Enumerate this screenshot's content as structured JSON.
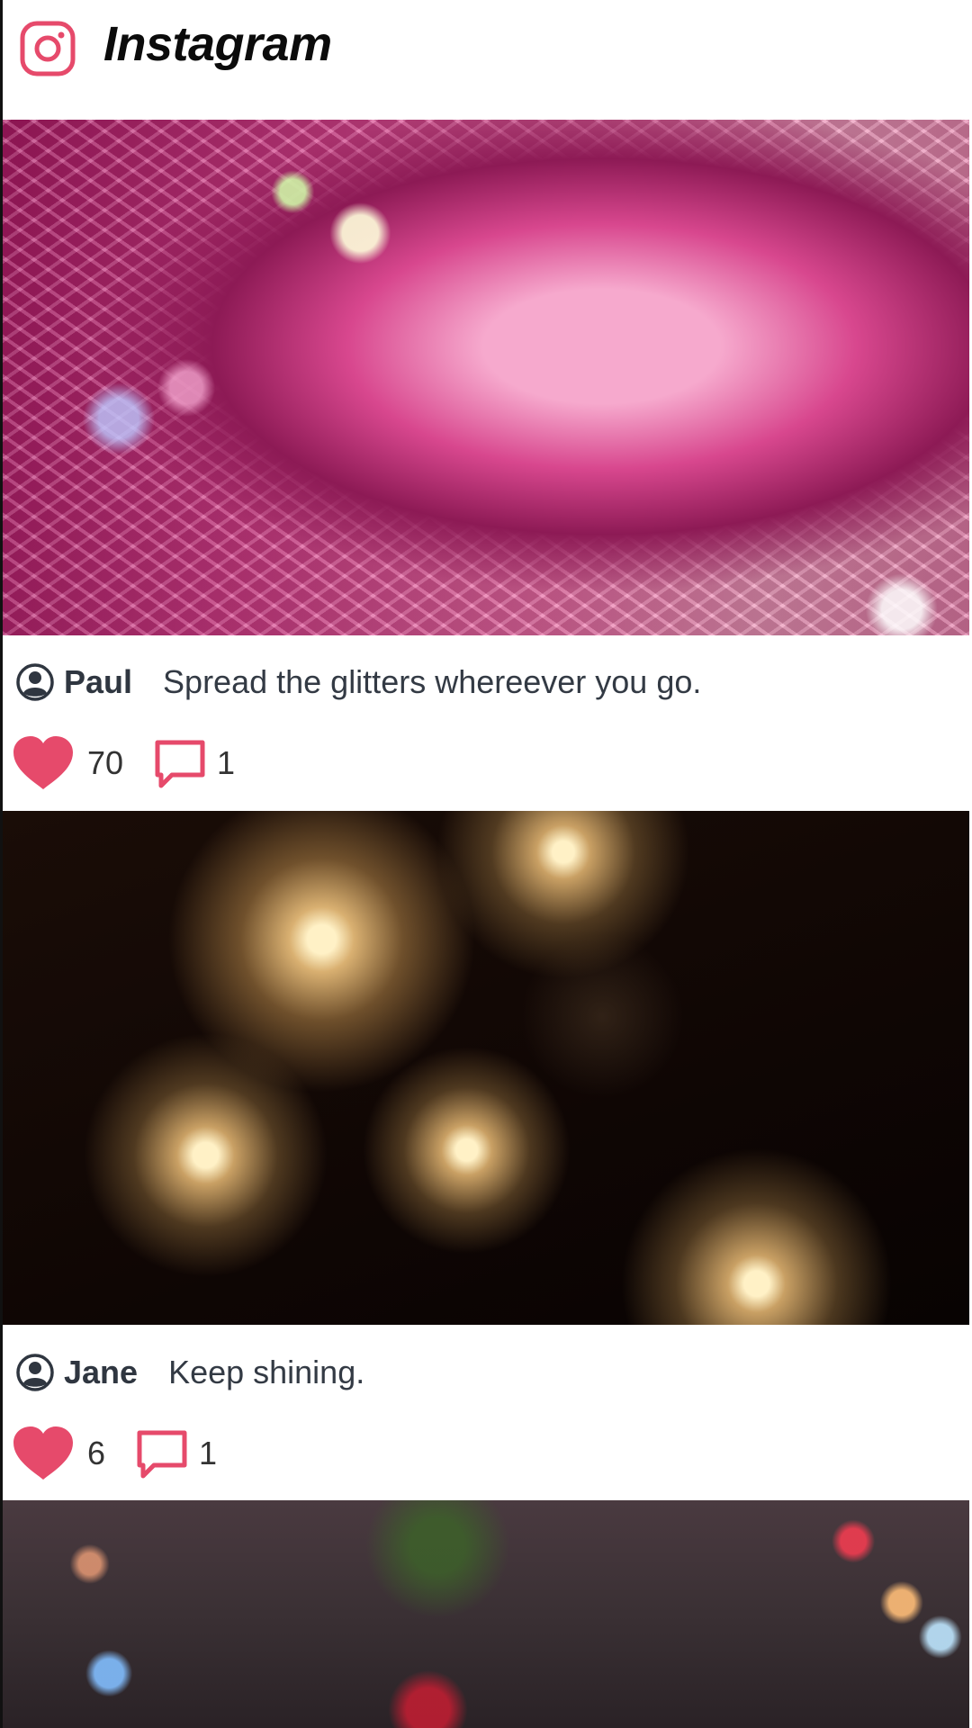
{
  "app": {
    "title": "Instagram",
    "logo_icon": "instagram-logo-icon",
    "brand_color": "#e64a6b"
  },
  "posts": [
    {
      "username": "Paul",
      "caption": "Spread the glitters whereever you go.",
      "likes": "70",
      "comments": "1",
      "image_subject": "pink disco ball"
    },
    {
      "username": "Jane",
      "caption": "Keep shining.",
      "likes": "6",
      "comments": "1",
      "image_subject": "glowing wire ball lights"
    },
    {
      "image_subject": "christmas tree tinsel and lights"
    }
  ],
  "icons": {
    "avatar": "user-circle-icon",
    "like": "heart-icon",
    "comment": "comment-icon"
  }
}
